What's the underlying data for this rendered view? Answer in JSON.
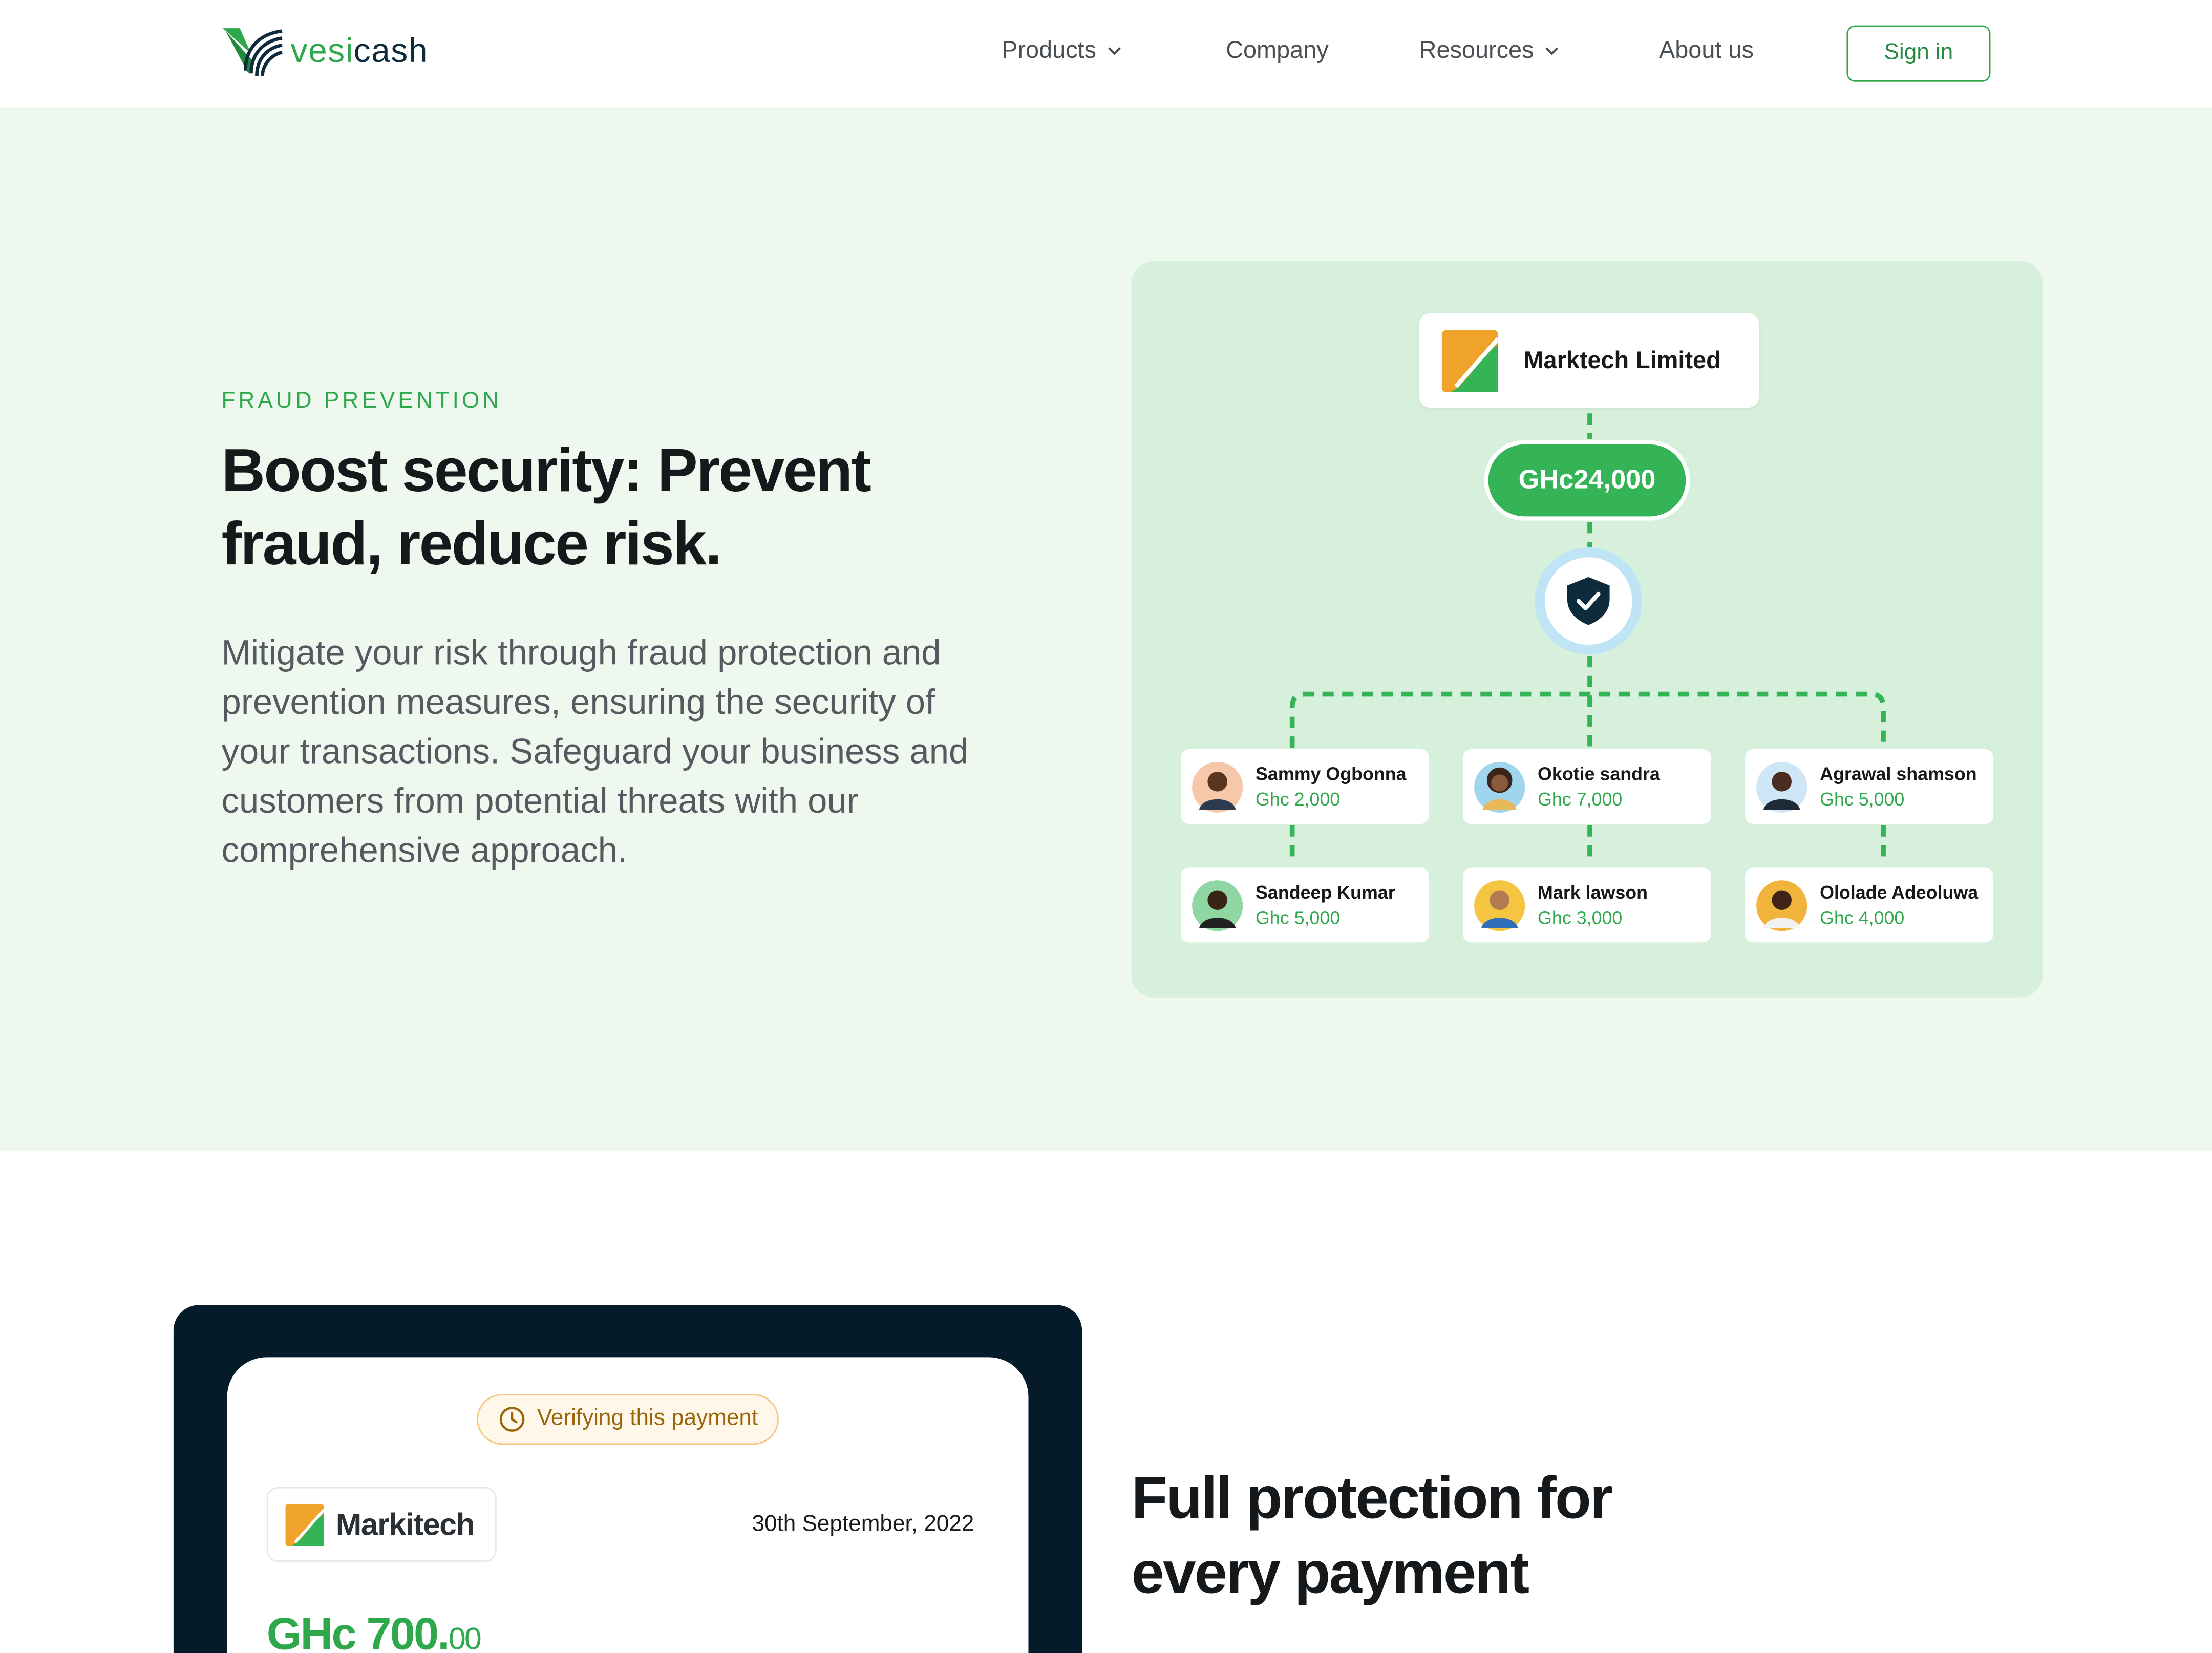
{
  "header": {
    "logo_text": "vesicash",
    "nav": [
      {
        "label": "Products",
        "dropdown": true
      },
      {
        "label": "Company",
        "dropdown": false
      },
      {
        "label": "Resources",
        "dropdown": true
      },
      {
        "label": "About us",
        "dropdown": false
      }
    ],
    "sign_in": "Sign in"
  },
  "hero": {
    "eyebrow": "FRAUD PREVENTION",
    "title": "Boost security: Prevent fraud, reduce risk.",
    "body": "Mitigate your risk through fraud protection and prevention measures, ensuring the security of your transactions. Safeguard your business and customers from potential threats with our comprehensive approach.",
    "diagram": {
      "company": "Marktech Limited",
      "total": "GHc24,000",
      "people": [
        {
          "name": "Sammy Ogbonna",
          "amount": "Ghc 2,000",
          "avatar_bg": "#f6c8a9"
        },
        {
          "name": "Okotie sandra",
          "amount": "Ghc 7,000",
          "avatar_bg": "#9fd6ee"
        },
        {
          "name": "Agrawal shamson",
          "amount": "Ghc 5,000",
          "avatar_bg": "#cfe6f6"
        },
        {
          "name": "Sandeep Kumar",
          "amount": "Ghc 5,000",
          "avatar_bg": "#8fd6a2"
        },
        {
          "name": "Mark lawson",
          "amount": "Ghc 3,000",
          "avatar_bg": "#f5c542"
        },
        {
          "name": "Ololade Adeoluwa",
          "amount": "Ghc 4,000",
          "avatar_bg": "#f0b43c"
        }
      ]
    }
  },
  "payment": {
    "status": "Verifying this payment",
    "merchant": "Markitech",
    "date": "30th September, 2022",
    "amount_main": "GHc 700.",
    "amount_cents": "00"
  },
  "section2": {
    "title": "Full protection for every payment"
  },
  "colors": {
    "brand_green": "#2ea84b",
    "navy": "#061b2a",
    "hero_bg": "#eef8ef",
    "panel_bg": "#d6f0dc"
  },
  "icons": [
    "vesicash-logo",
    "chevron-down-icon",
    "marktech-logo",
    "shield-check-icon",
    "avatar",
    "clock-icon"
  ]
}
